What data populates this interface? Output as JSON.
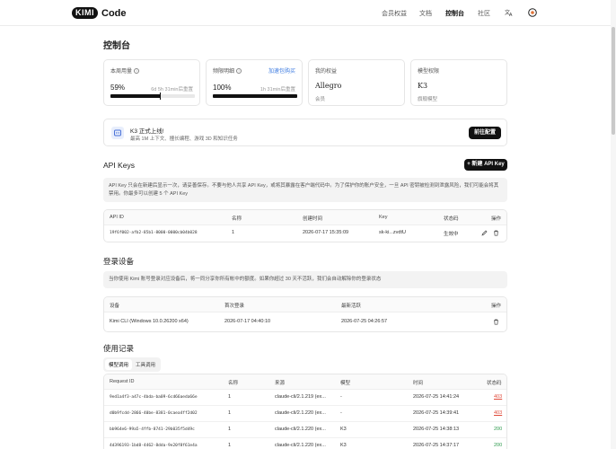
{
  "header": {
    "logo_badge": "KIMI",
    "logo_text": "Code",
    "nav": [
      "会员权益",
      "文档",
      "控制台",
      "社区"
    ],
    "active_nav": "控制台"
  },
  "page_title": "控制台",
  "cards": {
    "usage": {
      "label": "本周用量",
      "value": "59%",
      "reset": "6d 5h 31min后重置",
      "progress": 0.59
    },
    "rate": {
      "label": "频限明细",
      "link": "加速包购买",
      "value": "100%",
      "reset": "1h 31min后重置",
      "progress": 1.0
    },
    "plan": {
      "label": "我的权益",
      "value": "Allegro",
      "sub": "会员"
    },
    "model": {
      "label": "模型权限",
      "value": "K3",
      "sub": "旗舰模型"
    }
  },
  "banner": {
    "title": "K3 正式上线!",
    "subtitle": "最高 1M 上下文、擅长编程、游戏 3D 和知识任务",
    "button": "前往配置"
  },
  "api_keys": {
    "title": "API Keys",
    "new_button": "+ 新建 API Key",
    "note": "API Key 只会在新建后显示一次，请妥善保存。不要与他人共享 API Key，或将其暴露在客户端代码中。为了保护你的账户安全，一旦 API 密钥被检测到泄露风险，我们可能会将其禁用。你最多可以创建 5 个 API Key",
    "columns": [
      "API ID",
      "名称",
      "创建时间",
      "Key",
      "状态码",
      "操作"
    ],
    "rows": [
      {
        "id": "19f6f002-afb2-85b1-8000-0000cb04b028",
        "name": "1",
        "created": "2026-07-17 15:35:09",
        "key": "sk-ki...zvdtU",
        "status": "生效中"
      }
    ]
  },
  "devices": {
    "title": "登录设备",
    "note": "当你使用 Kimi 账号登录对应设备后，将一同分享你所有帐中的额度。如果你超过 30 天不活跃，我们会自动解除你的登录状态",
    "columns": [
      "设备",
      "首次登录",
      "最新活跃",
      "操作"
    ],
    "rows": [
      {
        "device": "Kimi CLI (Windows 10.0.26200 x64)",
        "first": "2026-07-17 04:40:10",
        "last": "2026-07-25 04:26:57"
      }
    ]
  },
  "usage": {
    "title": "使用记录",
    "tabs": [
      "模型调用",
      "工具调用"
    ],
    "columns": [
      "Request ID",
      "名称",
      "来源",
      "模型",
      "时间",
      "状态码"
    ],
    "rows": [
      {
        "id": "9ed1a4f3-a47c-4bda-ba09-6cd66aeda66e",
        "name": "1",
        "source": "claude-cli/2.1.219 (ex...",
        "model": "-",
        "time": "2026-07-25 14:41:24",
        "status": "403"
      },
      {
        "id": "d0b9fcdd-2866-40be-8381-0caea4ff2d02",
        "name": "1",
        "source": "claude-cli/2.1.220 (ex...",
        "model": "-",
        "time": "2026-07-25 14:39:41",
        "status": "403"
      },
      {
        "id": "bb964e6-99a5-4ffb-8741-29b035f5d49c",
        "name": "1",
        "source": "claude-cli/2.1.220 (ex...",
        "model": "K3",
        "time": "2026-07-25 14:38:13",
        "status": "200"
      },
      {
        "id": "4d396193-1bd8-4462-8dda-9e20f8f61e4a",
        "name": "1",
        "source": "claude-cli/2.1.220 (ex...",
        "model": "K3",
        "time": "2026-07-25 14:37:17",
        "status": "200"
      }
    ]
  }
}
